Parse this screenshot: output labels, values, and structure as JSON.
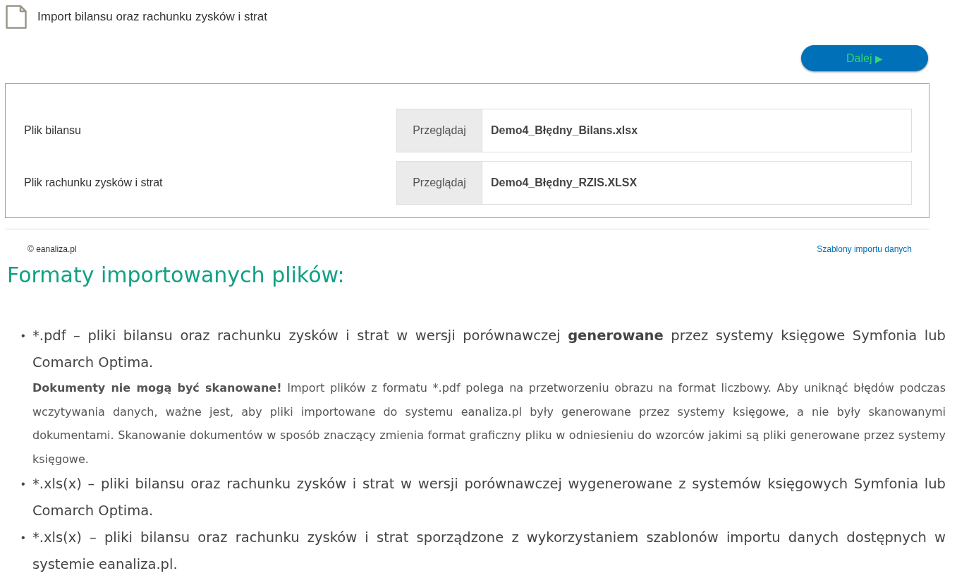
{
  "header": {
    "title": "Import bilansu oraz rachunku zysków i strat"
  },
  "next_button": {
    "label": "Dalej",
    "icon": "▶"
  },
  "files": [
    {
      "label": "Plik bilansu",
      "button": "Przeglądaj",
      "value": "Demo4_Błędny_Bilans.xlsx"
    },
    {
      "label": "Plik rachunku zysków i strat",
      "button": "Przeglądaj",
      "value": "Demo4_Błędny_RZIS.XLSX"
    }
  ],
  "footer": {
    "copyright": "© eanaliza.pl",
    "link": "Szablony importu danych"
  },
  "formats": {
    "heading": "Formaty importowanych plików:",
    "items": [
      {
        "marker": "•",
        "parts": [
          {
            "text": "*.pdf – pliki bilansu oraz rachunku zysków i strat w wersji porównawczej ",
            "bold": false
          },
          {
            "text": "generowane",
            "bold": true
          },
          {
            "text": " przez systemy księgowe Symfonia lub Comarch Optima.",
            "bold": false
          }
        ],
        "note": [
          {
            "text": "Dokumenty nie mogą być skanowane!",
            "bold": true
          },
          {
            "text": " Import plików z formatu *.pdf polega na przetworzeniu obrazu na format liczbowy. Aby uniknąć błędów podczas wczytywania danych, ważne jest, aby pliki importowane do systemu eanaliza.pl były generowane przez systemy księgowe, a nie były skanowanymi dokumentami. Skanowanie dokumentów w sposób znaczący zmienia format graficzny pliku w odniesieniu do wzorców jakimi są pliki generowane przez systemy księgowe.",
            "bold": false
          }
        ]
      },
      {
        "marker": "•",
        "parts": [
          {
            "text": "*.xls(x) – pliki bilansu oraz rachunku zysków i strat w wersji porównawczej wygenerowane z systemów księgowych Symfonia lub Comarch Optima.",
            "bold": false
          }
        ]
      },
      {
        "marker": "•",
        "parts": [
          {
            "text": "*.xls(x) – pliki bilansu oraz rachunku zysków i strat sporządzone z wykorzystaniem szablonów importu danych dostępnych w systemie eanaliza.pl.",
            "bold": false
          }
        ]
      }
    ]
  }
}
